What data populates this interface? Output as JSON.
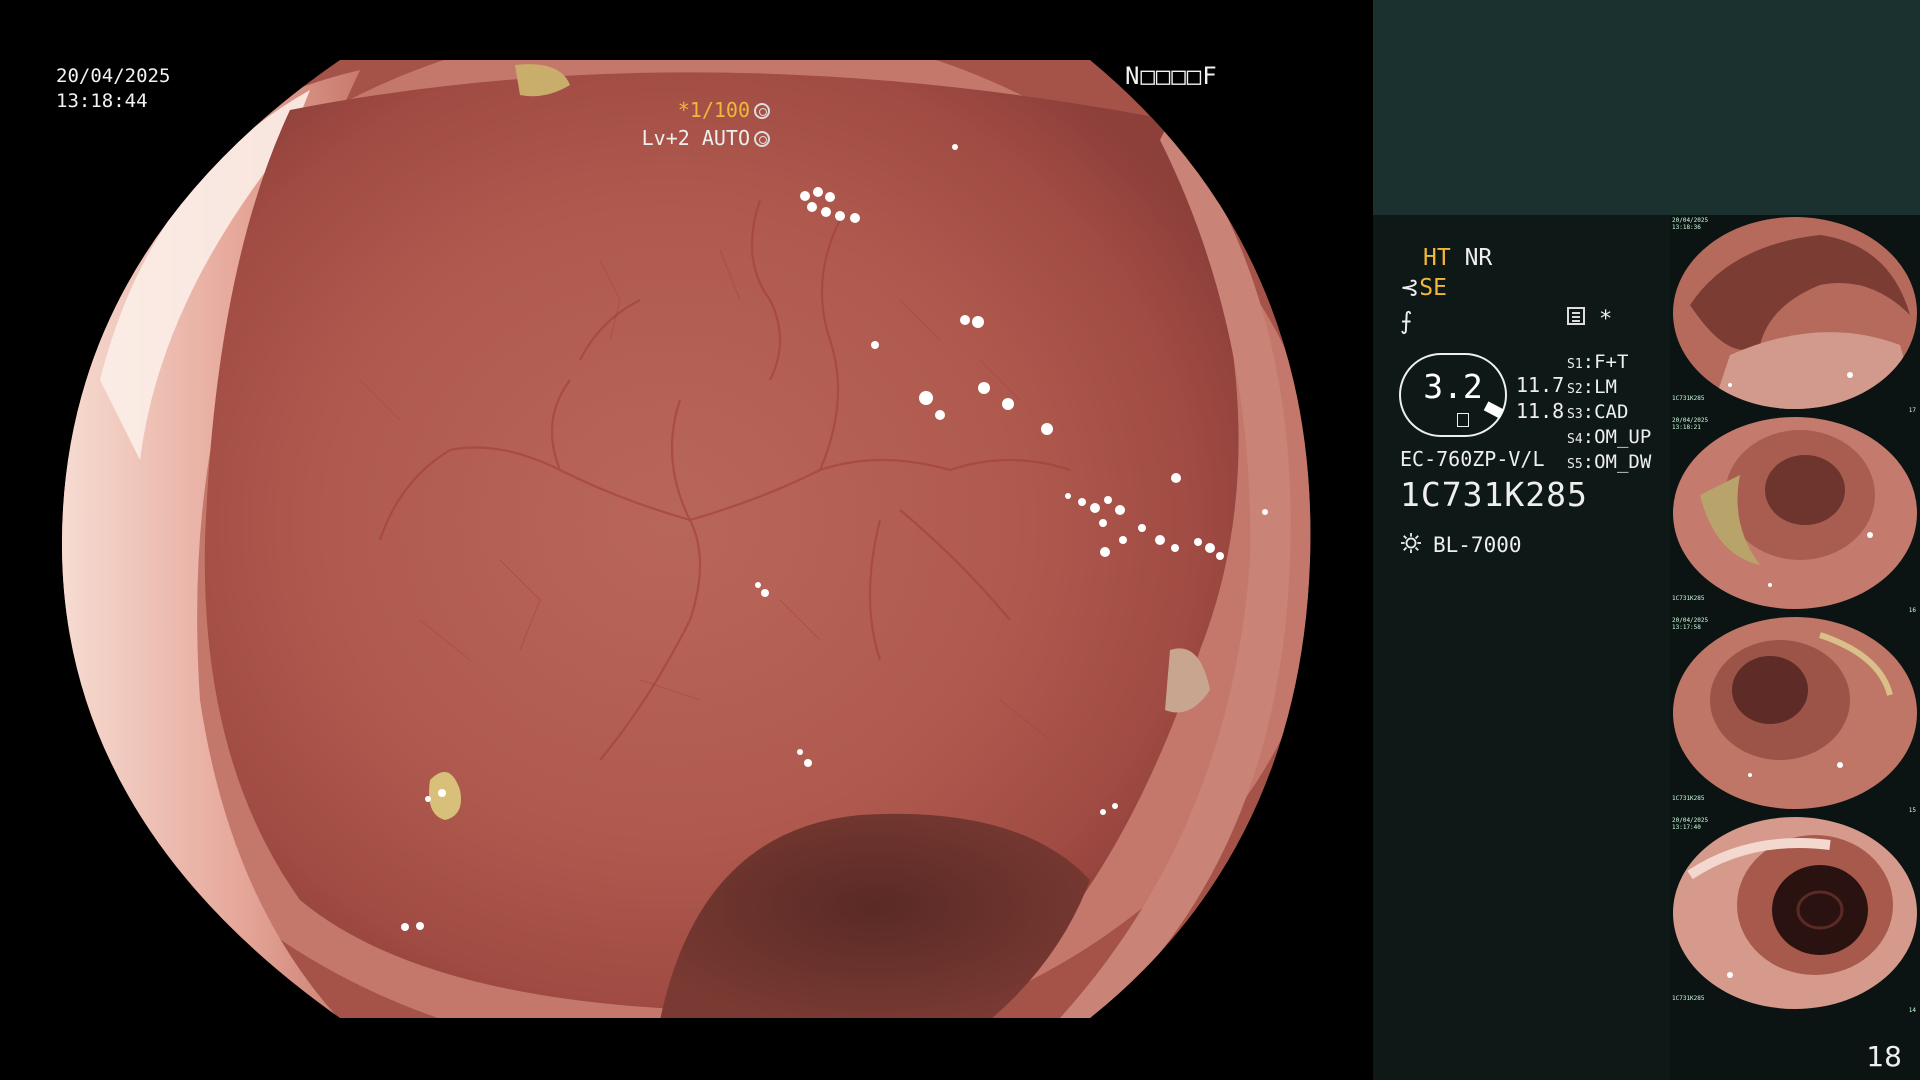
{
  "overlay": {
    "date": "20/04/2025",
    "time": "13:18:44",
    "channel": "N□□□□F",
    "shutter": "*1/100",
    "iris_level": "Lv+2",
    "iris_mode": "AUTO"
  },
  "info": {
    "ht_label": "HT",
    "nr_label": "NR",
    "se_label": "SE",
    "se_icon": "⊰",
    "star": "*",
    "gauge_value": "3.2",
    "value_a": "11.7",
    "value_b": "11.8",
    "scope_model": "EC-760ZP-V/L",
    "scope_serial": "1C731K285",
    "light_source": "BL-7000",
    "switches": [
      {
        "key": "S1",
        "value": "F+T"
      },
      {
        "key": "S2",
        "value": "LM"
      },
      {
        "key": "S3",
        "value": "CAD"
      },
      {
        "key": "S4",
        "value": "OM_UP"
      },
      {
        "key": "S5",
        "value": "OM_DW"
      }
    ]
  },
  "thumbnails": [
    {
      "date": "20/04/2025",
      "time": "13:18:36",
      "serial": "1C731K285",
      "num": "17"
    },
    {
      "date": "20/04/2025",
      "time": "13:18:21",
      "serial": "1C731K285",
      "num": "16"
    },
    {
      "date": "20/04/2025",
      "time": "13:17:58",
      "serial": "1C731K285",
      "num": "15"
    },
    {
      "date": "20/04/2025",
      "time": "13:17:40",
      "serial": "1C731K285",
      "num": "14"
    }
  ],
  "page_number": "18",
  "icons": {
    "shutter": "shutter-icon",
    "iris": "iris-icon",
    "memo": "memo-icon",
    "light": "light-source-icon"
  },
  "colors": {
    "panel_bg": "#0e1817",
    "panel_top": "#1b3130",
    "accent_yellow": "#f0b83a",
    "mucosa": "#b3564a"
  }
}
